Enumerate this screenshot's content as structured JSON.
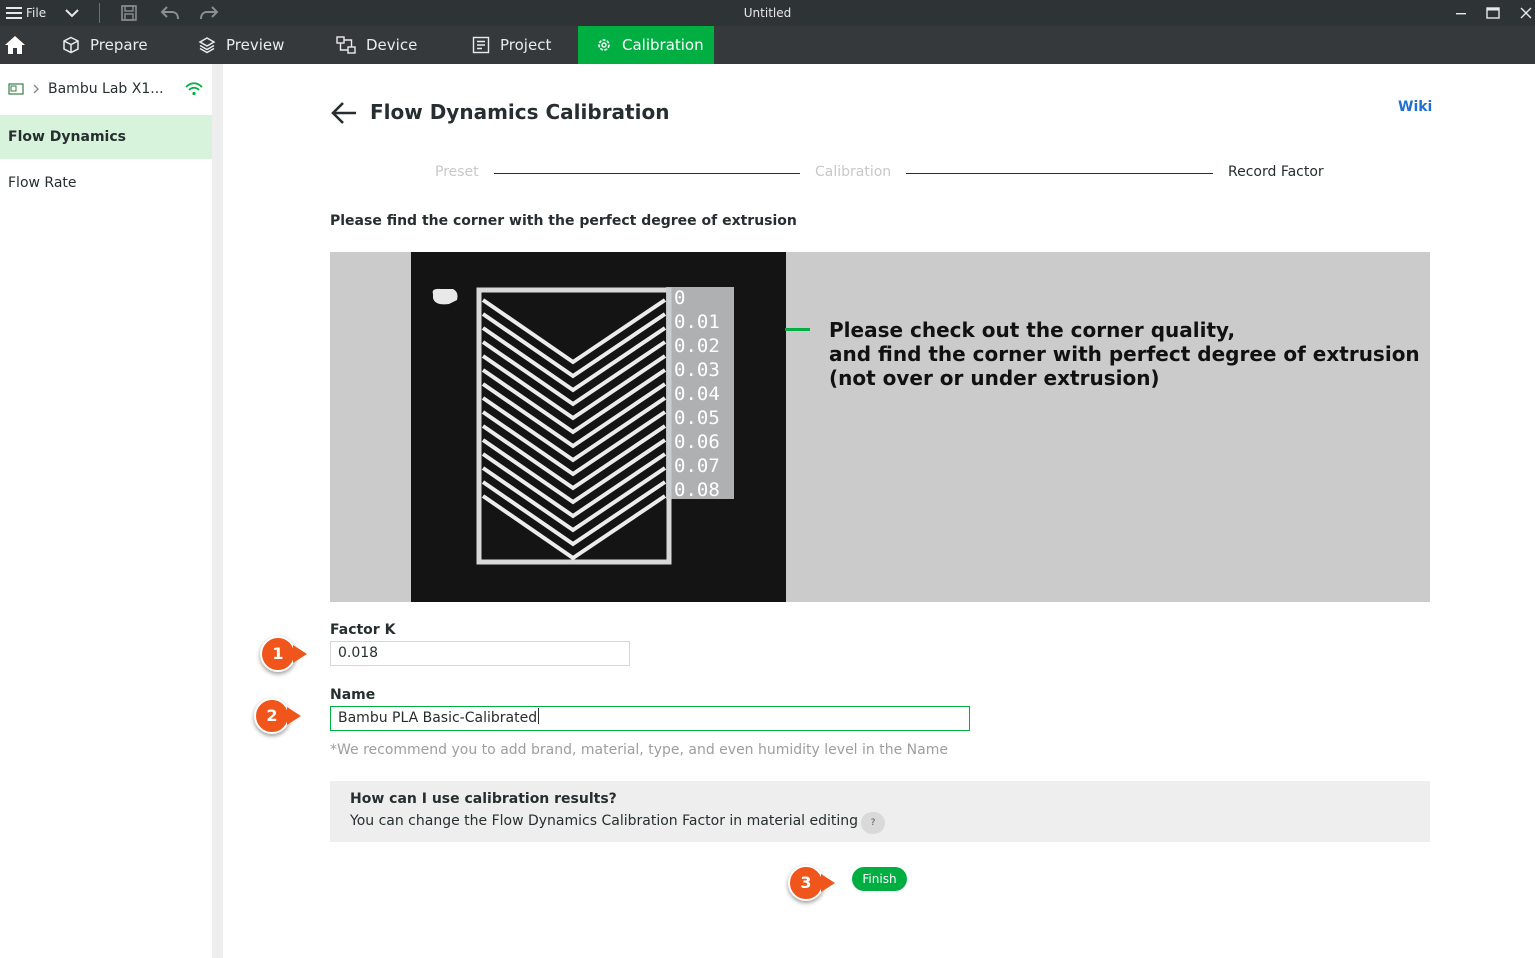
{
  "titlebar": {
    "file_label": "File",
    "window_title": "Untitled"
  },
  "tabs": [
    {
      "label": "Prepare",
      "icon": "cube-icon"
    },
    {
      "label": "Preview",
      "icon": "layers-icon"
    },
    {
      "label": "Device",
      "icon": "device-icon"
    },
    {
      "label": "Project",
      "icon": "project-icon"
    },
    {
      "label": "Calibration",
      "icon": "gear-icon",
      "active": true
    }
  ],
  "sidebar": {
    "printer_name": "Bambu Lab X1...",
    "items": [
      {
        "label": "Flow Dynamics",
        "active": true
      },
      {
        "label": "Flow Rate",
        "active": false
      }
    ]
  },
  "main": {
    "title": "Flow Dynamics Calibration",
    "wiki_label": "Wiki",
    "steps": [
      {
        "label": "Preset",
        "state": "done"
      },
      {
        "label": "Calibration",
        "state": "done"
      },
      {
        "label": "Record Factor",
        "state": "current"
      }
    ],
    "instruction": "Please find the corner with the perfect degree of extrusion",
    "image_caption": {
      "line1": "Please check out the corner quality,",
      "line2": "and find the corner with perfect degree of extrusion",
      "line3": "(not over or under extrusion)"
    },
    "photo_labels": [
      "0",
      "0.01",
      "0.02",
      "0.03",
      "0.04",
      "0.05",
      "0.06",
      "0.07",
      "0.08"
    ],
    "factor_k": {
      "label": "Factor K",
      "value": "0.018"
    },
    "name": {
      "label": "Name",
      "value": "Bambu PLA Basic-Calibrated"
    },
    "hint": "*We recommend you to add brand, material, type, and even humidity level in the Name",
    "info": {
      "title": "How can I use calibration results?",
      "text": "You can change the Flow Dynamics Calibration Factor in material editing",
      "help": "?"
    },
    "finish_label": "Finish"
  },
  "callouts": [
    "1",
    "2",
    "3"
  ],
  "colors": {
    "accent": "#00ae42",
    "callout": "#f0551b",
    "link": "#1f6fd6"
  }
}
